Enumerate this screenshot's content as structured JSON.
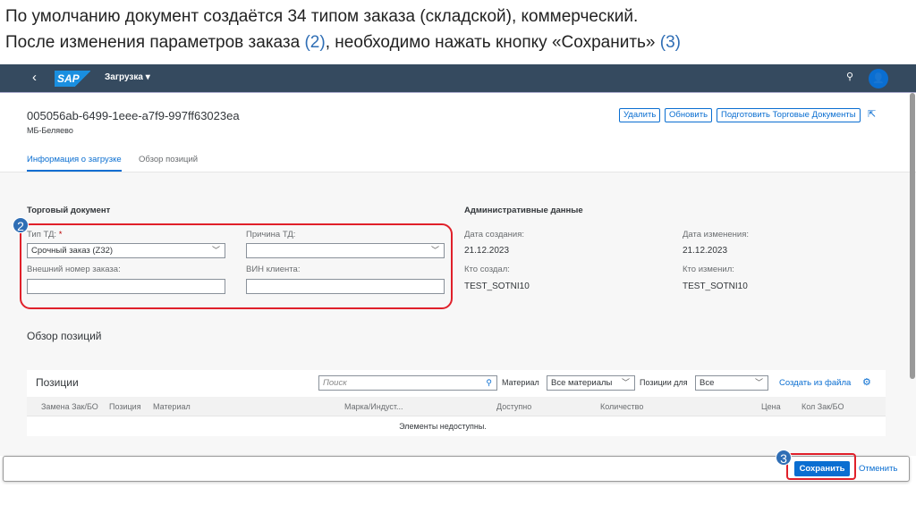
{
  "caption": {
    "line1": "По умолчанию документ создаётся 34 типом заказа (складской), коммерческий.",
    "line2_pre": "После изменения параметров заказа ",
    "line2_n2": "(2)",
    "line2_mid": ", необходимо нажать кнопку «Сохранить» ",
    "line2_n3": "(3)"
  },
  "shell": {
    "logo": "SAP",
    "app_title": "Загрузка ▾"
  },
  "header": {
    "title": "005056ab-6499-1eee-a7f9-997ff63023ea",
    "subtitle": "МБ-Беляево",
    "buttons": {
      "delete": "Удалить",
      "refresh": "Обновить",
      "prepare": "Подготовить Торговые Документы"
    }
  },
  "tabs": [
    "Информация о загрузке",
    "Обзор позиций"
  ],
  "trade_doc": {
    "heading": "Торговый документ",
    "type_label": "Тип ТД:",
    "required": "*",
    "type_value": "Срочный заказ (Z32)",
    "reason_label": "Причина ТД:",
    "reason_value": "",
    "ext_label": "Внешний номер заказа:",
    "ext_value": "",
    "vin_label": "ВИН клиента:",
    "vin_value": ""
  },
  "admin": {
    "heading": "Административные данные",
    "created_label": "Дата создания:",
    "created": "21.12.2023",
    "changed_label": "Дата изменения:",
    "changed": "21.12.2023",
    "creator_label": "Кто создал:",
    "creator": "TEST_SOTNI10",
    "changer_label": "Кто изменил:",
    "changer": "TEST_SOTNI10"
  },
  "positions_section": "Обзор позиций",
  "table": {
    "title": "Позиции",
    "search_placeholder": "Поиск",
    "material_label": "Материал",
    "material_value": "Все материалы",
    "pos_label": "Позиции для",
    "pos_value": "Все",
    "create_link": "Создать из файла",
    "columns": [
      "Замена Зак/БО",
      "Позиция",
      "Материал",
      "Марка/Индуст...",
      "Доступно",
      "Количество",
      "Цена",
      "Кол Зак/БО"
    ],
    "empty": "Элементы недоступны."
  },
  "footer": {
    "save": "Сохранить",
    "cancel": "Отменить"
  },
  "badges": {
    "b2": "2",
    "b3": "3"
  }
}
